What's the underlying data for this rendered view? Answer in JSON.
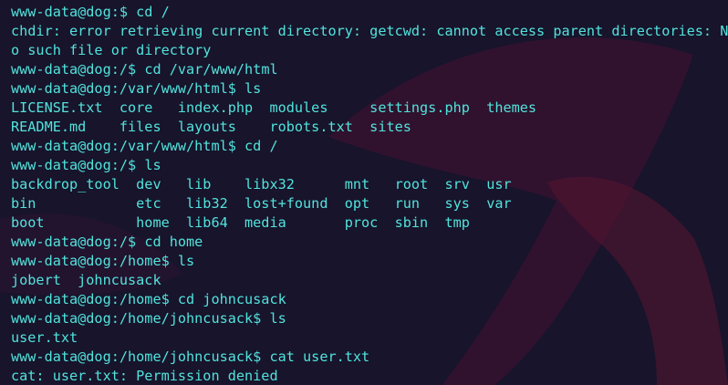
{
  "terminal": {
    "colors": {
      "background": "#17142b",
      "text": "#52e3dc",
      "art": "#7a1630"
    },
    "lines": [
      {
        "kind": "prompt",
        "prompt": "www-data@dog:$ ",
        "command": "cd /"
      },
      {
        "kind": "output",
        "text": "chdir: error retrieving current directory: getcwd: cannot access parent directories: N"
      },
      {
        "kind": "output",
        "text": "o such file or directory"
      },
      {
        "kind": "prompt",
        "prompt": "www-data@dog:/$ ",
        "command": "cd /var/www/html"
      },
      {
        "kind": "prompt",
        "prompt": "www-data@dog:/var/www/html$ ",
        "command": "ls"
      },
      {
        "kind": "output",
        "text": "LICENSE.txt  core   index.php  modules     settings.php  themes"
      },
      {
        "kind": "output",
        "text": "README.md    files  layouts    robots.txt  sites"
      },
      {
        "kind": "prompt",
        "prompt": "www-data@dog:/var/www/html$ ",
        "command": "cd /"
      },
      {
        "kind": "prompt",
        "prompt": "www-data@dog:/$ ",
        "command": "ls"
      },
      {
        "kind": "output",
        "text": "backdrop_tool  dev   lib    libx32      mnt   root  srv  usr"
      },
      {
        "kind": "output",
        "text": "bin            etc   lib32  lost+found  opt   run   sys  var"
      },
      {
        "kind": "output",
        "text": "boot           home  lib64  media       proc  sbin  tmp"
      },
      {
        "kind": "prompt",
        "prompt": "www-data@dog:/$ ",
        "command": "cd home"
      },
      {
        "kind": "prompt",
        "prompt": "www-data@dog:/home$ ",
        "command": "ls"
      },
      {
        "kind": "output",
        "text": "jobert  johncusack"
      },
      {
        "kind": "prompt",
        "prompt": "www-data@dog:/home$ ",
        "command": "cd johncusack"
      },
      {
        "kind": "prompt",
        "prompt": "www-data@dog:/home/johncusack$ ",
        "command": "ls"
      },
      {
        "kind": "output",
        "text": "user.txt"
      },
      {
        "kind": "prompt",
        "prompt": "www-data@dog:/home/johncusack$ ",
        "command": "cat user.txt"
      },
      {
        "kind": "output",
        "text": "cat: user.txt: Permission denied"
      }
    ]
  }
}
